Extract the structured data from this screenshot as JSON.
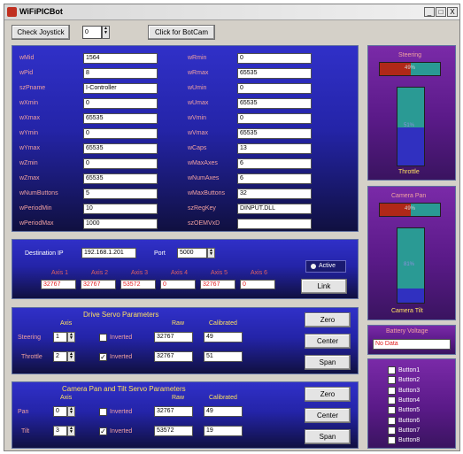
{
  "window": {
    "title": "WiFiPICBot",
    "minimize": "_",
    "restore": "□",
    "close": "X"
  },
  "toolbar": {
    "check_joystick": "Check Joystick",
    "joystick_value": "0",
    "botcam": "Click for BotCam"
  },
  "caps": {
    "left": [
      {
        "label": "wMid",
        "value": "1564"
      },
      {
        "label": "wPid",
        "value": "8"
      },
      {
        "label": "szPname",
        "value": "I-Controller"
      },
      {
        "label": "wXmin",
        "value": "0"
      },
      {
        "label": "wXmax",
        "value": "65535"
      },
      {
        "label": "wYmin",
        "value": "0"
      },
      {
        "label": "wYmax",
        "value": "65535"
      },
      {
        "label": "wZmin",
        "value": "0"
      },
      {
        "label": "wZmax",
        "value": "65535"
      },
      {
        "label": "wNumButtons",
        "value": "5"
      },
      {
        "label": "wPeriodMin",
        "value": "10"
      },
      {
        "label": "wPeriodMax",
        "value": "1000"
      }
    ],
    "right": [
      {
        "label": "wRmin",
        "value": "0"
      },
      {
        "label": "wRmax",
        "value": "65535"
      },
      {
        "label": "wUmin",
        "value": "0"
      },
      {
        "label": "wUmax",
        "value": "65535"
      },
      {
        "label": "wVmin",
        "value": "0"
      },
      {
        "label": "wVmax",
        "value": "65535"
      },
      {
        "label": "wCaps",
        "value": "13"
      },
      {
        "label": "wMaxAxes",
        "value": "6"
      },
      {
        "label": "wNumAxes",
        "value": "6"
      },
      {
        "label": "wMaxButtons",
        "value": "32"
      },
      {
        "label": "szRegKey",
        "value": "DINPUT.DLL"
      },
      {
        "label": "szOEMVxD",
        "value": ""
      }
    ]
  },
  "network": {
    "dest_ip_label": "Destination IP",
    "dest_ip": "192.168.1.201",
    "port_label": "Port",
    "port": "5000",
    "active_label": "Active",
    "link": "Link",
    "axes": [
      {
        "label": "Axis 1",
        "value": "32767"
      },
      {
        "label": "Axis 2",
        "value": "32767"
      },
      {
        "label": "Axis 3",
        "value": "53572"
      },
      {
        "label": "Axis 4",
        "value": "0"
      },
      {
        "label": "Axis 5",
        "value": "32767"
      },
      {
        "label": "Axis 6",
        "value": "0"
      }
    ]
  },
  "drive": {
    "title": "Drive Servo Parameters",
    "col_axis": "Axis",
    "col_raw": "Raw",
    "col_cal": "Calibrated",
    "rows": [
      {
        "label": "Steering",
        "axis": "1",
        "inverted_label": "Inverted",
        "inverted": false,
        "raw": "32767",
        "cal": "49"
      },
      {
        "label": "Throttle",
        "axis": "2",
        "inverted_label": "Inverted",
        "inverted": true,
        "raw": "32767",
        "cal": "51"
      }
    ],
    "zero": "Zero",
    "center": "Center",
    "span": "Span"
  },
  "cam": {
    "title": "Camera Pan and Tilt Servo Parameters",
    "col_axis": "Axis",
    "col_raw": "Raw",
    "col_cal": "Calibrated",
    "rows": [
      {
        "label": "Pan",
        "axis": "0",
        "inverted_label": "Inverted",
        "inverted": false,
        "raw": "32767",
        "cal": "49"
      },
      {
        "label": "Tilt",
        "axis": "3",
        "inverted_label": "Inverted",
        "inverted": true,
        "raw": "53572",
        "cal": "19"
      }
    ],
    "zero": "Zero",
    "center": "Center",
    "span": "Span"
  },
  "steering_panel": {
    "title": "Steering",
    "steering_value": "49%",
    "steering_fraction": 0.49,
    "throttle_label": "Throttle",
    "throttle_value": "51%",
    "throttle_fraction": 0.51
  },
  "camera_panel": {
    "title": "Camera Pan",
    "pan_value": "49%",
    "pan_fraction": 0.49,
    "tilt_label": "Camera Tilt",
    "tilt_value": "81%",
    "tilt_fraction": 0.81
  },
  "battery": {
    "title": "Battery Voltage",
    "value": "No Data"
  },
  "buttons": [
    "Button1",
    "Button2",
    "Button3",
    "Button4",
    "Button5",
    "Button6",
    "Button7",
    "Button8"
  ],
  "colors": {
    "teal": "#2a9a94",
    "red_fill": "#b02818",
    "blue_fill": "#3030c0"
  }
}
